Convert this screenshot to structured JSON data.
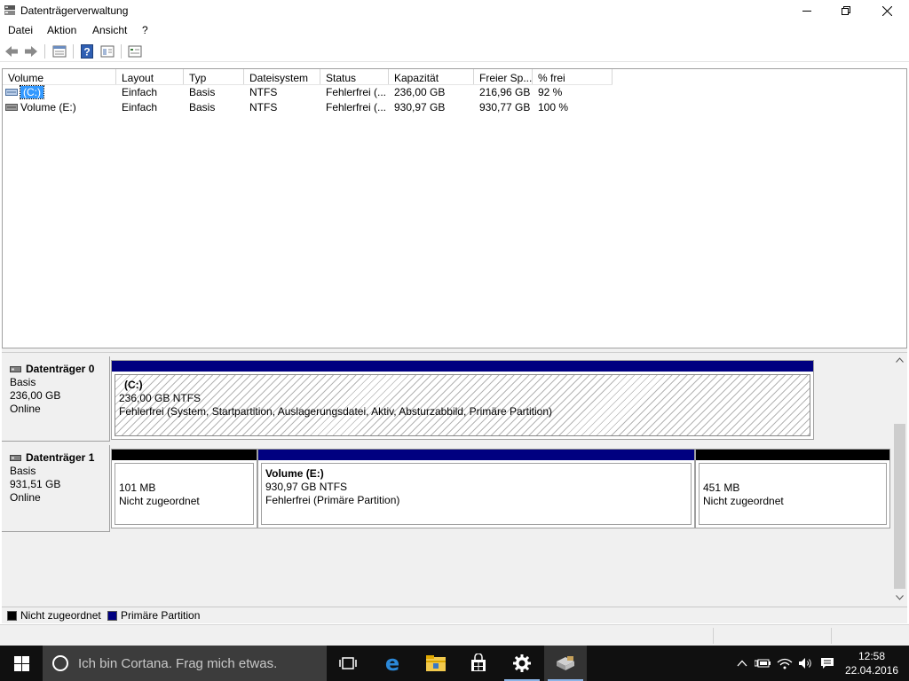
{
  "window": {
    "title": "Datenträgerverwaltung"
  },
  "menu": [
    "Datei",
    "Aktion",
    "Ansicht",
    "?"
  ],
  "toolbar": [
    "back-icon",
    "forward-icon",
    "list-view-icon",
    "help-icon",
    "properties-icon",
    "settings-icon"
  ],
  "volume_table": {
    "columns": [
      "Volume",
      "Layout",
      "Typ",
      "Dateisystem",
      "Status",
      "Kapazität",
      "Freier Sp...",
      "% frei"
    ],
    "rows": [
      {
        "volume": "(C:)",
        "layout": "Einfach",
        "typ": "Basis",
        "fs": "NTFS",
        "status": "Fehlerfrei (...",
        "capacity": "236,00 GB",
        "free": "216,96 GB",
        "pct": "92 %",
        "selected": true
      },
      {
        "volume": "Volume (E:)",
        "layout": "Einfach",
        "typ": "Basis",
        "fs": "NTFS",
        "status": "Fehlerfrei (...",
        "capacity": "930,97 GB",
        "free": "930,77 GB",
        "pct": "100 %",
        "selected": false
      }
    ]
  },
  "disks": [
    {
      "name": "Datenträger 0",
      "type": "Basis",
      "size": "236,00 GB",
      "state": "Online",
      "partitions": [
        {
          "title": "(C:)",
          "size": "236,00 GB NTFS",
          "status": "Fehlerfrei (System, Startpartition, Auslagerungsdatei, Aktiv, Absturzabbild, Primäre Partition)",
          "kind": "primary",
          "selected": true
        }
      ]
    },
    {
      "name": "Datenträger 1",
      "type": "Basis",
      "size": "931,51 GB",
      "state": "Online",
      "partitions": [
        {
          "title": "",
          "size": "101 MB",
          "status": "Nicht zugeordnet",
          "kind": "unallocated"
        },
        {
          "title": "Volume  (E:)",
          "size": "930,97 GB NTFS",
          "status": "Fehlerfrei (Primäre Partition)",
          "kind": "primary"
        },
        {
          "title": "",
          "size": "451 MB",
          "status": "Nicht zugeordnet",
          "kind": "unallocated"
        }
      ]
    }
  ],
  "legend": [
    {
      "label": "Nicht zugeordnet",
      "color": "#000000"
    },
    {
      "label": "Primäre Partition",
      "color": "#000080"
    }
  ],
  "taskbar": {
    "search_placeholder": "Ich bin Cortana. Frag mich etwas.",
    "apps": [
      "task-view-icon",
      "edge-icon",
      "file-explorer-icon",
      "store-icon",
      "settings-icon",
      "disk-management-icon"
    ],
    "time": "12:58",
    "date": "22.04.2016"
  },
  "colors": {
    "primary_partition": "#000080",
    "unallocated": "#000000",
    "selection": "#3399ff"
  }
}
